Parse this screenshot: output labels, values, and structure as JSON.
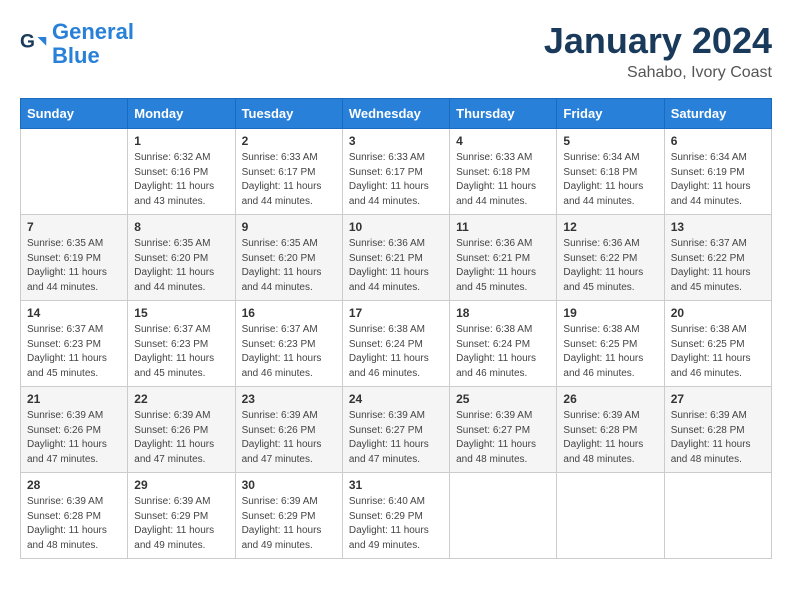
{
  "logo": {
    "text_general": "General",
    "text_blue": "Blue"
  },
  "title": "January 2024",
  "subtitle": "Sahabo, Ivory Coast",
  "weekdays": [
    "Sunday",
    "Monday",
    "Tuesday",
    "Wednesday",
    "Thursday",
    "Friday",
    "Saturday"
  ],
  "weeks": [
    [
      {
        "day": "",
        "sunrise": "",
        "sunset": "",
        "daylight": ""
      },
      {
        "day": "1",
        "sunrise": "Sunrise: 6:32 AM",
        "sunset": "Sunset: 6:16 PM",
        "daylight": "Daylight: 11 hours and 43 minutes."
      },
      {
        "day": "2",
        "sunrise": "Sunrise: 6:33 AM",
        "sunset": "Sunset: 6:17 PM",
        "daylight": "Daylight: 11 hours and 44 minutes."
      },
      {
        "day": "3",
        "sunrise": "Sunrise: 6:33 AM",
        "sunset": "Sunset: 6:17 PM",
        "daylight": "Daylight: 11 hours and 44 minutes."
      },
      {
        "day": "4",
        "sunrise": "Sunrise: 6:33 AM",
        "sunset": "Sunset: 6:18 PM",
        "daylight": "Daylight: 11 hours and 44 minutes."
      },
      {
        "day": "5",
        "sunrise": "Sunrise: 6:34 AM",
        "sunset": "Sunset: 6:18 PM",
        "daylight": "Daylight: 11 hours and 44 minutes."
      },
      {
        "day": "6",
        "sunrise": "Sunrise: 6:34 AM",
        "sunset": "Sunset: 6:19 PM",
        "daylight": "Daylight: 11 hours and 44 minutes."
      }
    ],
    [
      {
        "day": "7",
        "sunrise": "Sunrise: 6:35 AM",
        "sunset": "Sunset: 6:19 PM",
        "daylight": "Daylight: 11 hours and 44 minutes."
      },
      {
        "day": "8",
        "sunrise": "Sunrise: 6:35 AM",
        "sunset": "Sunset: 6:20 PM",
        "daylight": "Daylight: 11 hours and 44 minutes."
      },
      {
        "day": "9",
        "sunrise": "Sunrise: 6:35 AM",
        "sunset": "Sunset: 6:20 PM",
        "daylight": "Daylight: 11 hours and 44 minutes."
      },
      {
        "day": "10",
        "sunrise": "Sunrise: 6:36 AM",
        "sunset": "Sunset: 6:21 PM",
        "daylight": "Daylight: 11 hours and 44 minutes."
      },
      {
        "day": "11",
        "sunrise": "Sunrise: 6:36 AM",
        "sunset": "Sunset: 6:21 PM",
        "daylight": "Daylight: 11 hours and 45 minutes."
      },
      {
        "day": "12",
        "sunrise": "Sunrise: 6:36 AM",
        "sunset": "Sunset: 6:22 PM",
        "daylight": "Daylight: 11 hours and 45 minutes."
      },
      {
        "day": "13",
        "sunrise": "Sunrise: 6:37 AM",
        "sunset": "Sunset: 6:22 PM",
        "daylight": "Daylight: 11 hours and 45 minutes."
      }
    ],
    [
      {
        "day": "14",
        "sunrise": "Sunrise: 6:37 AM",
        "sunset": "Sunset: 6:23 PM",
        "daylight": "Daylight: 11 hours and 45 minutes."
      },
      {
        "day": "15",
        "sunrise": "Sunrise: 6:37 AM",
        "sunset": "Sunset: 6:23 PM",
        "daylight": "Daylight: 11 hours and 45 minutes."
      },
      {
        "day": "16",
        "sunrise": "Sunrise: 6:37 AM",
        "sunset": "Sunset: 6:23 PM",
        "daylight": "Daylight: 11 hours and 46 minutes."
      },
      {
        "day": "17",
        "sunrise": "Sunrise: 6:38 AM",
        "sunset": "Sunset: 6:24 PM",
        "daylight": "Daylight: 11 hours and 46 minutes."
      },
      {
        "day": "18",
        "sunrise": "Sunrise: 6:38 AM",
        "sunset": "Sunset: 6:24 PM",
        "daylight": "Daylight: 11 hours and 46 minutes."
      },
      {
        "day": "19",
        "sunrise": "Sunrise: 6:38 AM",
        "sunset": "Sunset: 6:25 PM",
        "daylight": "Daylight: 11 hours and 46 minutes."
      },
      {
        "day": "20",
        "sunrise": "Sunrise: 6:38 AM",
        "sunset": "Sunset: 6:25 PM",
        "daylight": "Daylight: 11 hours and 46 minutes."
      }
    ],
    [
      {
        "day": "21",
        "sunrise": "Sunrise: 6:39 AM",
        "sunset": "Sunset: 6:26 PM",
        "daylight": "Daylight: 11 hours and 47 minutes."
      },
      {
        "day": "22",
        "sunrise": "Sunrise: 6:39 AM",
        "sunset": "Sunset: 6:26 PM",
        "daylight": "Daylight: 11 hours and 47 minutes."
      },
      {
        "day": "23",
        "sunrise": "Sunrise: 6:39 AM",
        "sunset": "Sunset: 6:26 PM",
        "daylight": "Daylight: 11 hours and 47 minutes."
      },
      {
        "day": "24",
        "sunrise": "Sunrise: 6:39 AM",
        "sunset": "Sunset: 6:27 PM",
        "daylight": "Daylight: 11 hours and 47 minutes."
      },
      {
        "day": "25",
        "sunrise": "Sunrise: 6:39 AM",
        "sunset": "Sunset: 6:27 PM",
        "daylight": "Daylight: 11 hours and 48 minutes."
      },
      {
        "day": "26",
        "sunrise": "Sunrise: 6:39 AM",
        "sunset": "Sunset: 6:28 PM",
        "daylight": "Daylight: 11 hours and 48 minutes."
      },
      {
        "day": "27",
        "sunrise": "Sunrise: 6:39 AM",
        "sunset": "Sunset: 6:28 PM",
        "daylight": "Daylight: 11 hours and 48 minutes."
      }
    ],
    [
      {
        "day": "28",
        "sunrise": "Sunrise: 6:39 AM",
        "sunset": "Sunset: 6:28 PM",
        "daylight": "Daylight: 11 hours and 48 minutes."
      },
      {
        "day": "29",
        "sunrise": "Sunrise: 6:39 AM",
        "sunset": "Sunset: 6:29 PM",
        "daylight": "Daylight: 11 hours and 49 minutes."
      },
      {
        "day": "30",
        "sunrise": "Sunrise: 6:39 AM",
        "sunset": "Sunset: 6:29 PM",
        "daylight": "Daylight: 11 hours and 49 minutes."
      },
      {
        "day": "31",
        "sunrise": "Sunrise: 6:40 AM",
        "sunset": "Sunset: 6:29 PM",
        "daylight": "Daylight: 11 hours and 49 minutes."
      },
      {
        "day": "",
        "sunrise": "",
        "sunset": "",
        "daylight": ""
      },
      {
        "day": "",
        "sunrise": "",
        "sunset": "",
        "daylight": ""
      },
      {
        "day": "",
        "sunrise": "",
        "sunset": "",
        "daylight": ""
      }
    ]
  ]
}
